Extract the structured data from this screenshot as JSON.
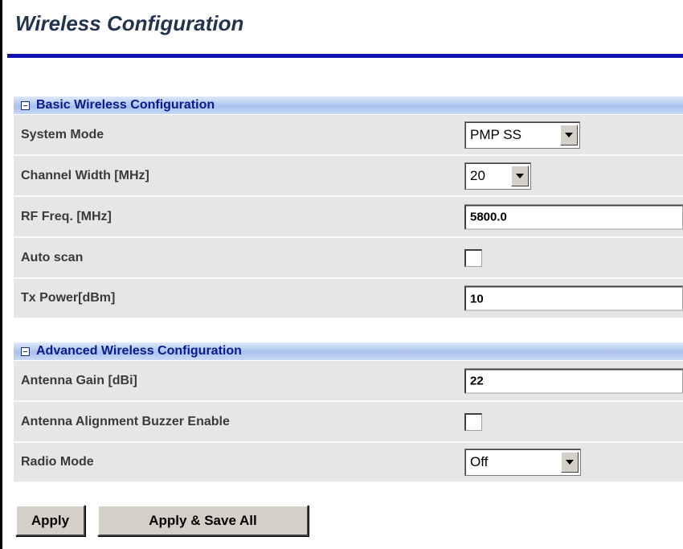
{
  "page": {
    "title": "Wireless Configuration"
  },
  "basic": {
    "section_title": "Basic Wireless Configuration",
    "system_mode": {
      "label": "System Mode",
      "value": "PMP SS"
    },
    "channel_width": {
      "label": "Channel Width [MHz]",
      "value": "20"
    },
    "rf_freq": {
      "label": "RF Freq. [MHz]",
      "value": "5800.0"
    },
    "auto_scan": {
      "label": "Auto scan",
      "checked": false
    },
    "tx_power": {
      "label": "Tx Power[dBm]",
      "value": "10"
    }
  },
  "advanced": {
    "section_title": "Advanced Wireless Configuration",
    "antenna_gain": {
      "label": "Antenna Gain [dBi]",
      "value": "22"
    },
    "buzzer": {
      "label": "Antenna Alignment Buzzer Enable",
      "checked": false
    },
    "radio_mode": {
      "label": "Radio Mode",
      "value": "Off"
    }
  },
  "buttons": {
    "apply": "Apply",
    "apply_save_all": "Apply & Save All"
  },
  "colors": {
    "title_rule": "#1212b4",
    "section_header": "#aac2ee",
    "row_bg": "#e6e6e6"
  },
  "icons": {
    "section_toggle": "collapse-minus-icon",
    "dropdown": "chevron-down-icon"
  }
}
